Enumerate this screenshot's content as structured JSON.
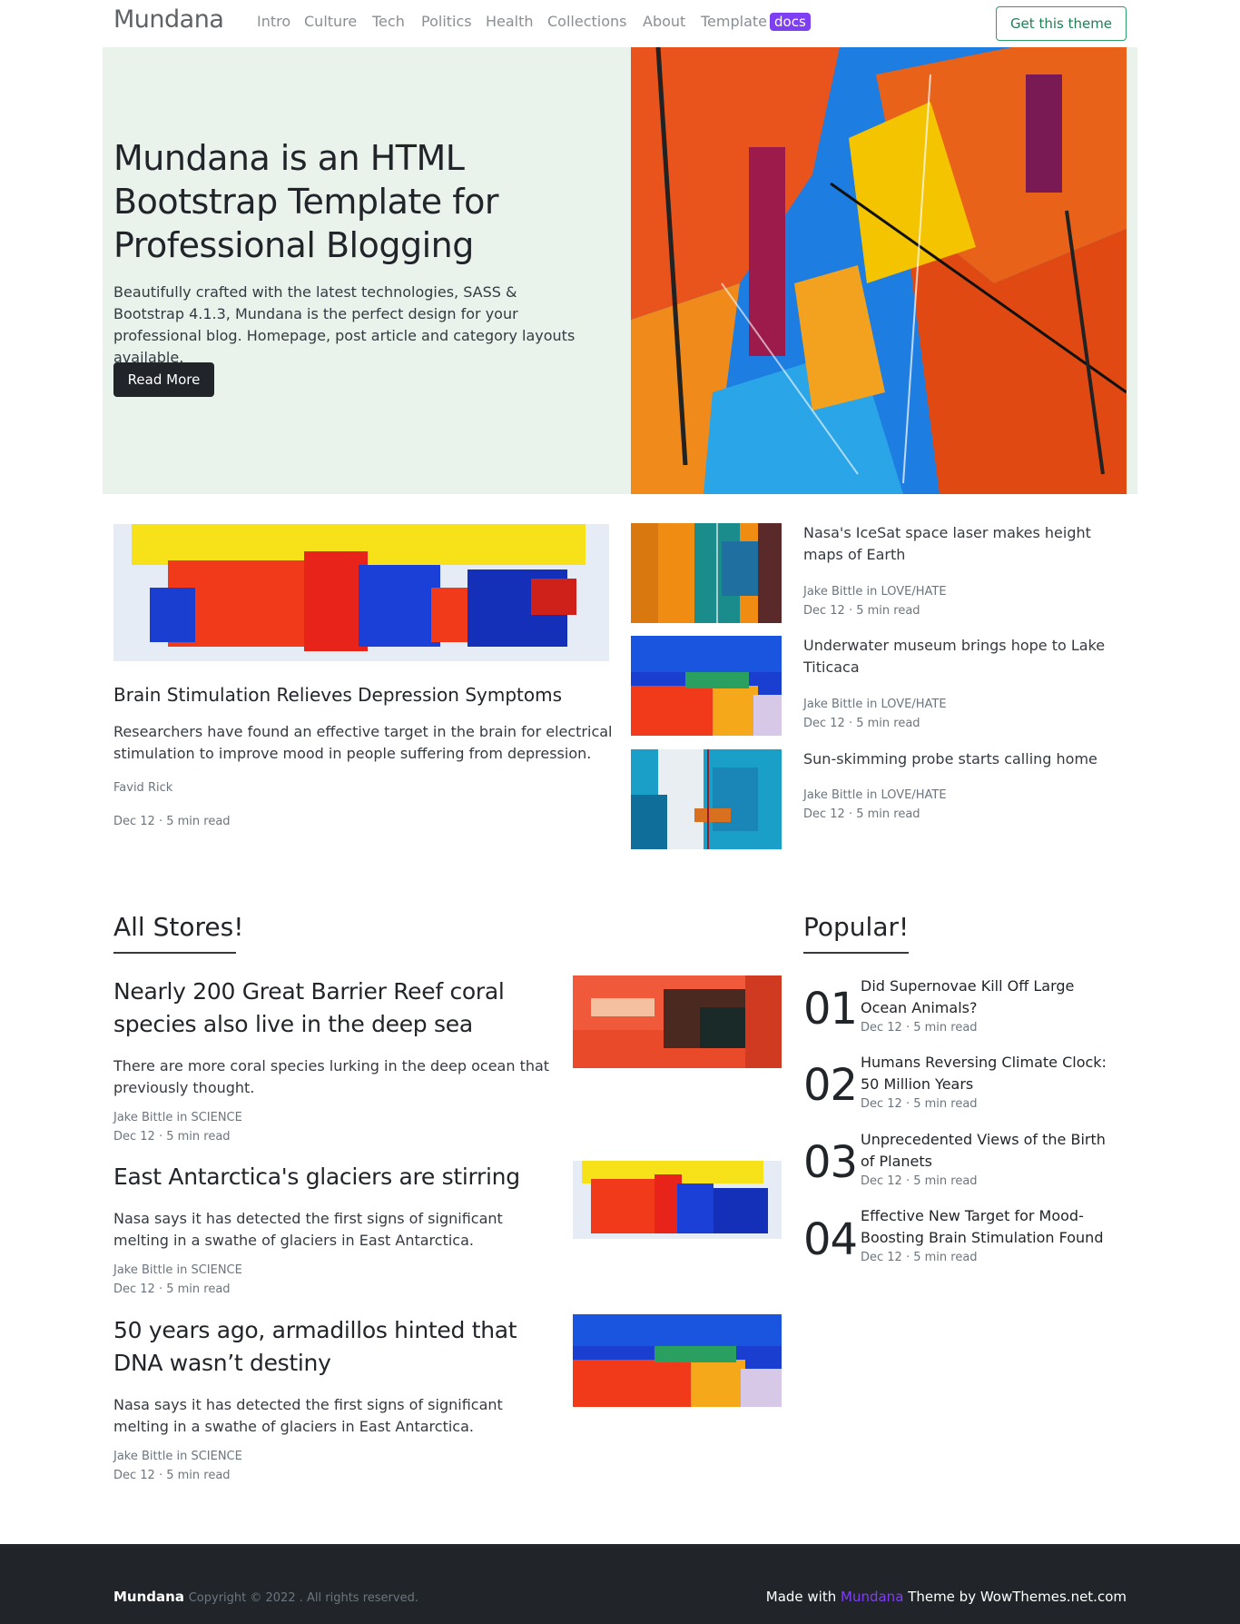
{
  "nav": {
    "brand": "Mundana",
    "links": [
      "Intro",
      "Culture",
      "Tech",
      "Politics",
      "Health",
      "Collections",
      "About",
      "Template"
    ],
    "badge": "docs",
    "cta": "Get this theme"
  },
  "hero": {
    "title": "Mundana is an HTML Bootstrap Template for Professional Blogging",
    "text": "Beautifully crafted with the latest technologies, SASS & Bootstrap 4.1.3, Mundana is the perfect design for your professional blog. Homepage, post article and category layouts available.",
    "button": "Read More"
  },
  "featured": {
    "title": "Brain Stimulation Relieves Depression Symptoms",
    "text": "Researchers have found an effective target in the brain for electrical stimulation to improve mood in people suffering from depression.",
    "author": "Favid Rick",
    "meta": "Dec 12 · 5 min read"
  },
  "side_posts": [
    {
      "title": "Nasa's IceSat space laser makes height maps of Earth",
      "author": "Jake Bittle in LOVE/HATE",
      "meta": "Dec 12 · 5 min read"
    },
    {
      "title": "Underwater museum brings hope to Lake Titicaca",
      "author": "Jake Bittle in LOVE/HATE",
      "meta": "Dec 12 · 5 min read"
    },
    {
      "title": "Sun-skimming probe starts calling home",
      "author": "Jake Bittle in LOVE/HATE",
      "meta": "Dec 12 · 5 min read"
    }
  ],
  "all_stories": {
    "heading": "All Stores!",
    "items": [
      {
        "title": "Nearly 200 Great Barrier Reef coral species also live in the deep sea",
        "text": "There are more coral species lurking in the deep ocean that previously thought.",
        "author": "Jake Bittle in SCIENCE",
        "meta": "Dec 12 · 5 min read"
      },
      {
        "title": "East Antarctica's glaciers are stirring",
        "text": "Nasa says it has detected the first signs of significant melting in a swathe of glaciers in East Antarctica.",
        "author": "Jake Bittle in SCIENCE",
        "meta": "Dec 12 · 5 min read"
      },
      {
        "title": "50 years ago, armadillos hinted that DNA wasn’t destiny",
        "text": "Nasa says it has detected the first signs of significant melting in a swathe of glaciers in East Antarctica.",
        "author": "Jake Bittle in SCIENCE",
        "meta": "Dec 12 · 5 min read"
      }
    ]
  },
  "popular": {
    "heading": "Popular!",
    "items": [
      {
        "num": "01",
        "title": "Did Supernovae Kill Off Large Ocean Animals?",
        "meta": "Dec 12 · 5 min read"
      },
      {
        "num": "02",
        "title": "Humans Reversing Climate Clock: 50 Million Years",
        "meta": "Dec 12 · 5 min read"
      },
      {
        "num": "03",
        "title": "Unprecedented Views of the Birth of Planets",
        "meta": "Dec 12 · 5 min read"
      },
      {
        "num": "04",
        "title": "Effective New Target for Mood-Boosting Brain Stimulation Found",
        "meta": "Dec 12 · 5 min read"
      }
    ]
  },
  "footer": {
    "brand": "Mundana",
    "copyright": "Copyright © 2022 . All rights reserved.",
    "made_prefix": "Made with",
    "made_brand": "Mundana",
    "made_suffix": "Theme by WowThemes.net.com"
  },
  "colors": {
    "accent": "#7e3ff2",
    "hero_bg": "#e9f3ec",
    "footer_bg": "#212529",
    "cta_border": "#28a068"
  }
}
